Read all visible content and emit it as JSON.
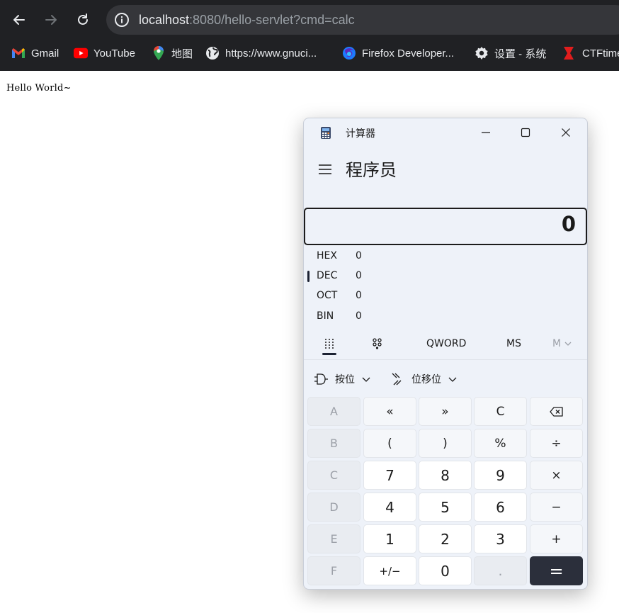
{
  "browser": {
    "url_host": "localhost",
    "url_rest": ":8080/hello-servlet?cmd=calc",
    "bookmarks": [
      {
        "label": "Gmail",
        "icon": "gmail-icon"
      },
      {
        "label": "YouTube",
        "icon": "youtube-icon"
      },
      {
        "label": "地图",
        "icon": "maps-icon"
      },
      {
        "label": "https://www.gnuci...",
        "icon": "globe-icon"
      },
      {
        "label": "Firefox Developer...",
        "icon": "firefox-icon"
      },
      {
        "label": "设置 - 系统",
        "icon": "gear-icon"
      },
      {
        "label": "CTFtime",
        "icon": "ctftime-icon"
      }
    ]
  },
  "page": {
    "text": "Hello World~"
  },
  "calculator": {
    "window_title": "计算器",
    "mode_title": "程序员",
    "display_value": "0",
    "radix": [
      {
        "label": "HEX",
        "value": "0"
      },
      {
        "label": "DEC",
        "value": "0",
        "selected": true
      },
      {
        "label": "OCT",
        "value": "0"
      },
      {
        "label": "BIN",
        "value": "0"
      }
    ],
    "modes": {
      "word_size": "QWORD",
      "memory_store": "MS",
      "memory_menu": "M"
    },
    "ops": {
      "bitwise": "按位",
      "bitshift": "位移位"
    },
    "keys": [
      [
        "A",
        "«",
        "»",
        "C",
        "⌫"
      ],
      [
        "B",
        "(",
        ")",
        "%",
        "÷"
      ],
      [
        "C",
        "7",
        "8",
        "9",
        "×"
      ],
      [
        "D",
        "4",
        "5",
        "6",
        "−"
      ],
      [
        "E",
        "1",
        "2",
        "3",
        "+"
      ],
      [
        "F",
        "+/−",
        "0",
        ".",
        "="
      ]
    ],
    "colors": {
      "window_bg": "#eef2f9",
      "equals_bg": "#2b2f3b"
    }
  }
}
